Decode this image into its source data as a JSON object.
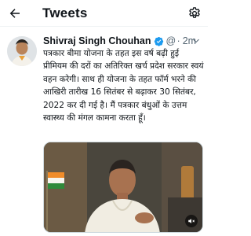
{
  "header": {
    "title": "Tweets",
    "back_icon": "arrow-left-icon",
    "settings_icon": "gear-icon"
  },
  "tweet": {
    "author_name": "Shivraj Singh Chouhan",
    "handle": "@",
    "separator": "·",
    "time": "2m",
    "text": "पत्रकार बीमा योजना के तहत इस वर्ष बढ़ी हुई प्रीमियम की दरों का अतिरिक्त खर्च प्रदेश सरकार स्वयं वहन करेगी। साथ ही योजना के तहत फॉर्म भरने की आखिरी तारीख 16 सितंबर से बढ़ाकर 30 सितंबर, 2022 कर दी गई है। मैं पत्रकार बंधुओं के उत्तम स्वास्थ्य की मंगल कामना करता हूँ।",
    "verified_icon": "verified-badge-icon",
    "media_icon": "speaker-mute-icon"
  },
  "colors": {
    "accent": "#1d9bf0",
    "muted_text": "#536471",
    "border": "#eff3f4"
  }
}
